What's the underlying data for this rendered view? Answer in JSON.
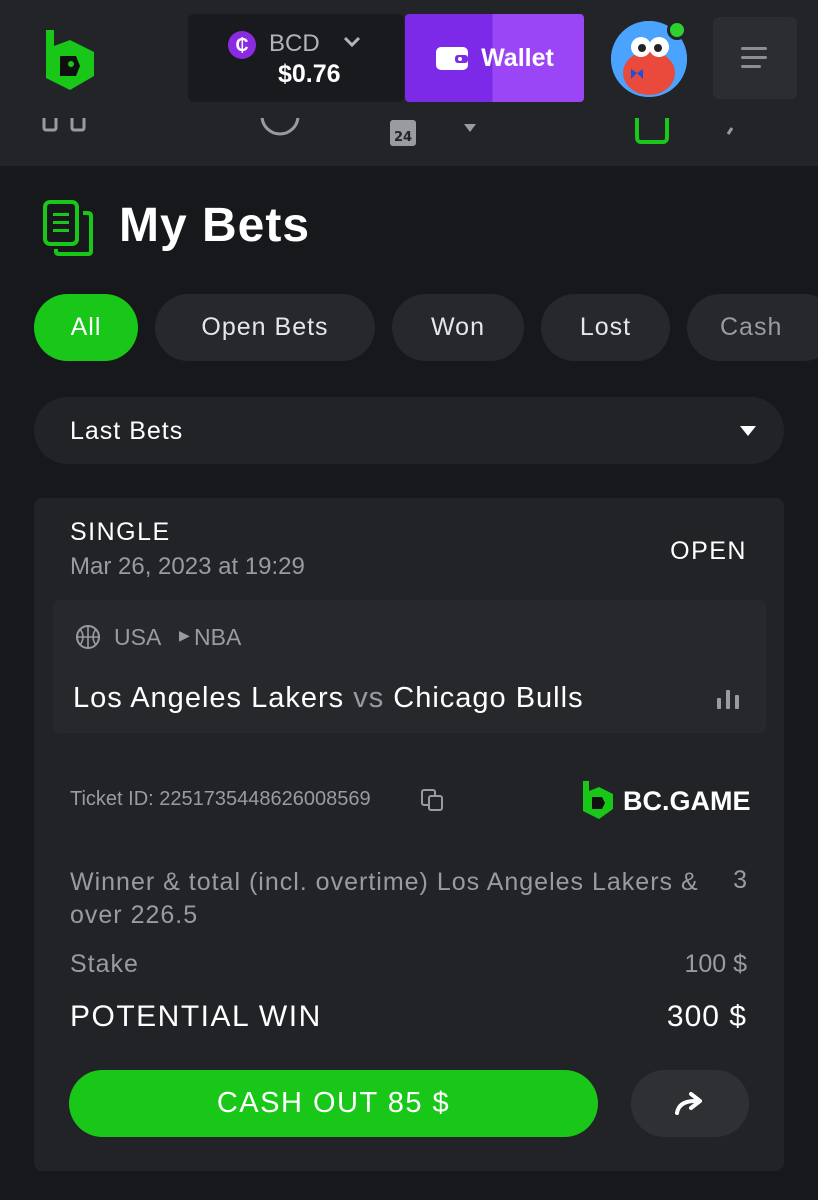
{
  "header": {
    "currency": {
      "code": "BCD",
      "balance": "$0.76",
      "coin_symbol": "₵",
      "coin_color": "#8a2be2"
    },
    "wallet_label": "Wallet",
    "accent_color": "#19c719"
  },
  "page": {
    "title": "My Bets"
  },
  "filters": {
    "chips": [
      "All",
      "Open Bets",
      "Won",
      "Lost",
      "Cash"
    ],
    "active": "All"
  },
  "dropdown": {
    "selected": "Last Bets"
  },
  "bet": {
    "type": "SINGLE",
    "date": "Mar 26, 2023 at 19:29",
    "status": "OPEN",
    "country": "USA",
    "league": "NBA",
    "home_team": "Los Angeles Lakers",
    "vs": "vs",
    "away_team": "Chicago Bulls",
    "ticket_id": "Ticket ID: 2251735448626008569",
    "brand": "BC.GAME",
    "market": "Winner & total (incl. overtime) Los Angeles Lakers & over 226.5",
    "odds": "3",
    "stake_label": "Stake",
    "stake_value": "100 $",
    "potential_win_label": "POTENTIAL WIN",
    "potential_win_value": "300 $",
    "cashout_label": "CASH OUT 85 $"
  }
}
